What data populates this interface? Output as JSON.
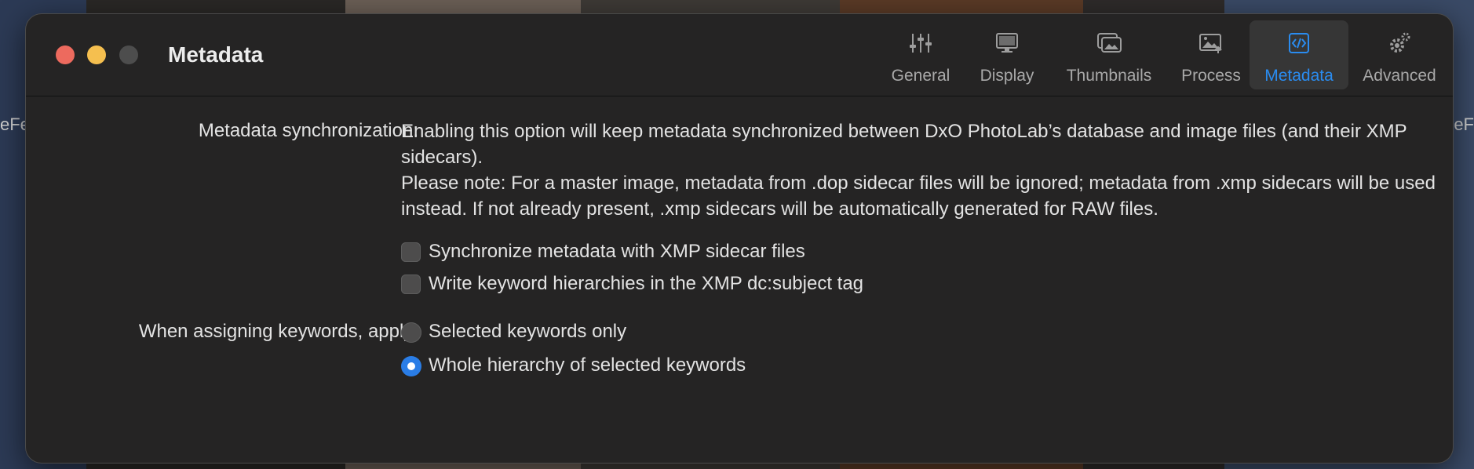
{
  "window": {
    "title": "Metadata"
  },
  "tabs": [
    {
      "label": "General",
      "icon": "sliders-icon",
      "active": false
    },
    {
      "label": "Display",
      "icon": "monitor-icon",
      "active": false
    },
    {
      "label": "Thumbnails",
      "icon": "thumbnails-icon",
      "active": false
    },
    {
      "label": "Process",
      "icon": "image-export-icon",
      "active": false
    },
    {
      "label": "Metadata",
      "icon": "code-document-icon",
      "active": true
    },
    {
      "label": "Advanced",
      "icon": "gears-icon",
      "active": false
    }
  ],
  "background": {
    "left_fragment": "eFe",
    "right_fragment": "ceF"
  },
  "sync": {
    "label": "Metadata synchronization:",
    "description_1": "Enabling this option will keep metadata synchronized between DxO PhotoLab’s database and image files (and their XMP sidecars).",
    "description_2": "Please note: For a master image, metadata from .dop sidecar files will be ignored; metadata from .xmp sidecars will be used instead. If not already present, .xmp sidecars will be automatically generated for RAW files.",
    "options": [
      {
        "label": "Synchronize metadata with XMP sidecar files",
        "checked": false
      },
      {
        "label": "Write keyword hierarchies in the XMP dc:subject tag",
        "checked": false
      }
    ]
  },
  "keywords": {
    "label": "When assigning keywords, apply:",
    "options": [
      {
        "label": "Selected keywords only",
        "selected": false
      },
      {
        "label": "Whole hierarchy of selected keywords",
        "selected": true
      }
    ]
  },
  "colors": {
    "accent": "#2a8cf0",
    "window_bg": "#252424",
    "close": "#ed6a5e",
    "minimize": "#f5bf4f"
  }
}
